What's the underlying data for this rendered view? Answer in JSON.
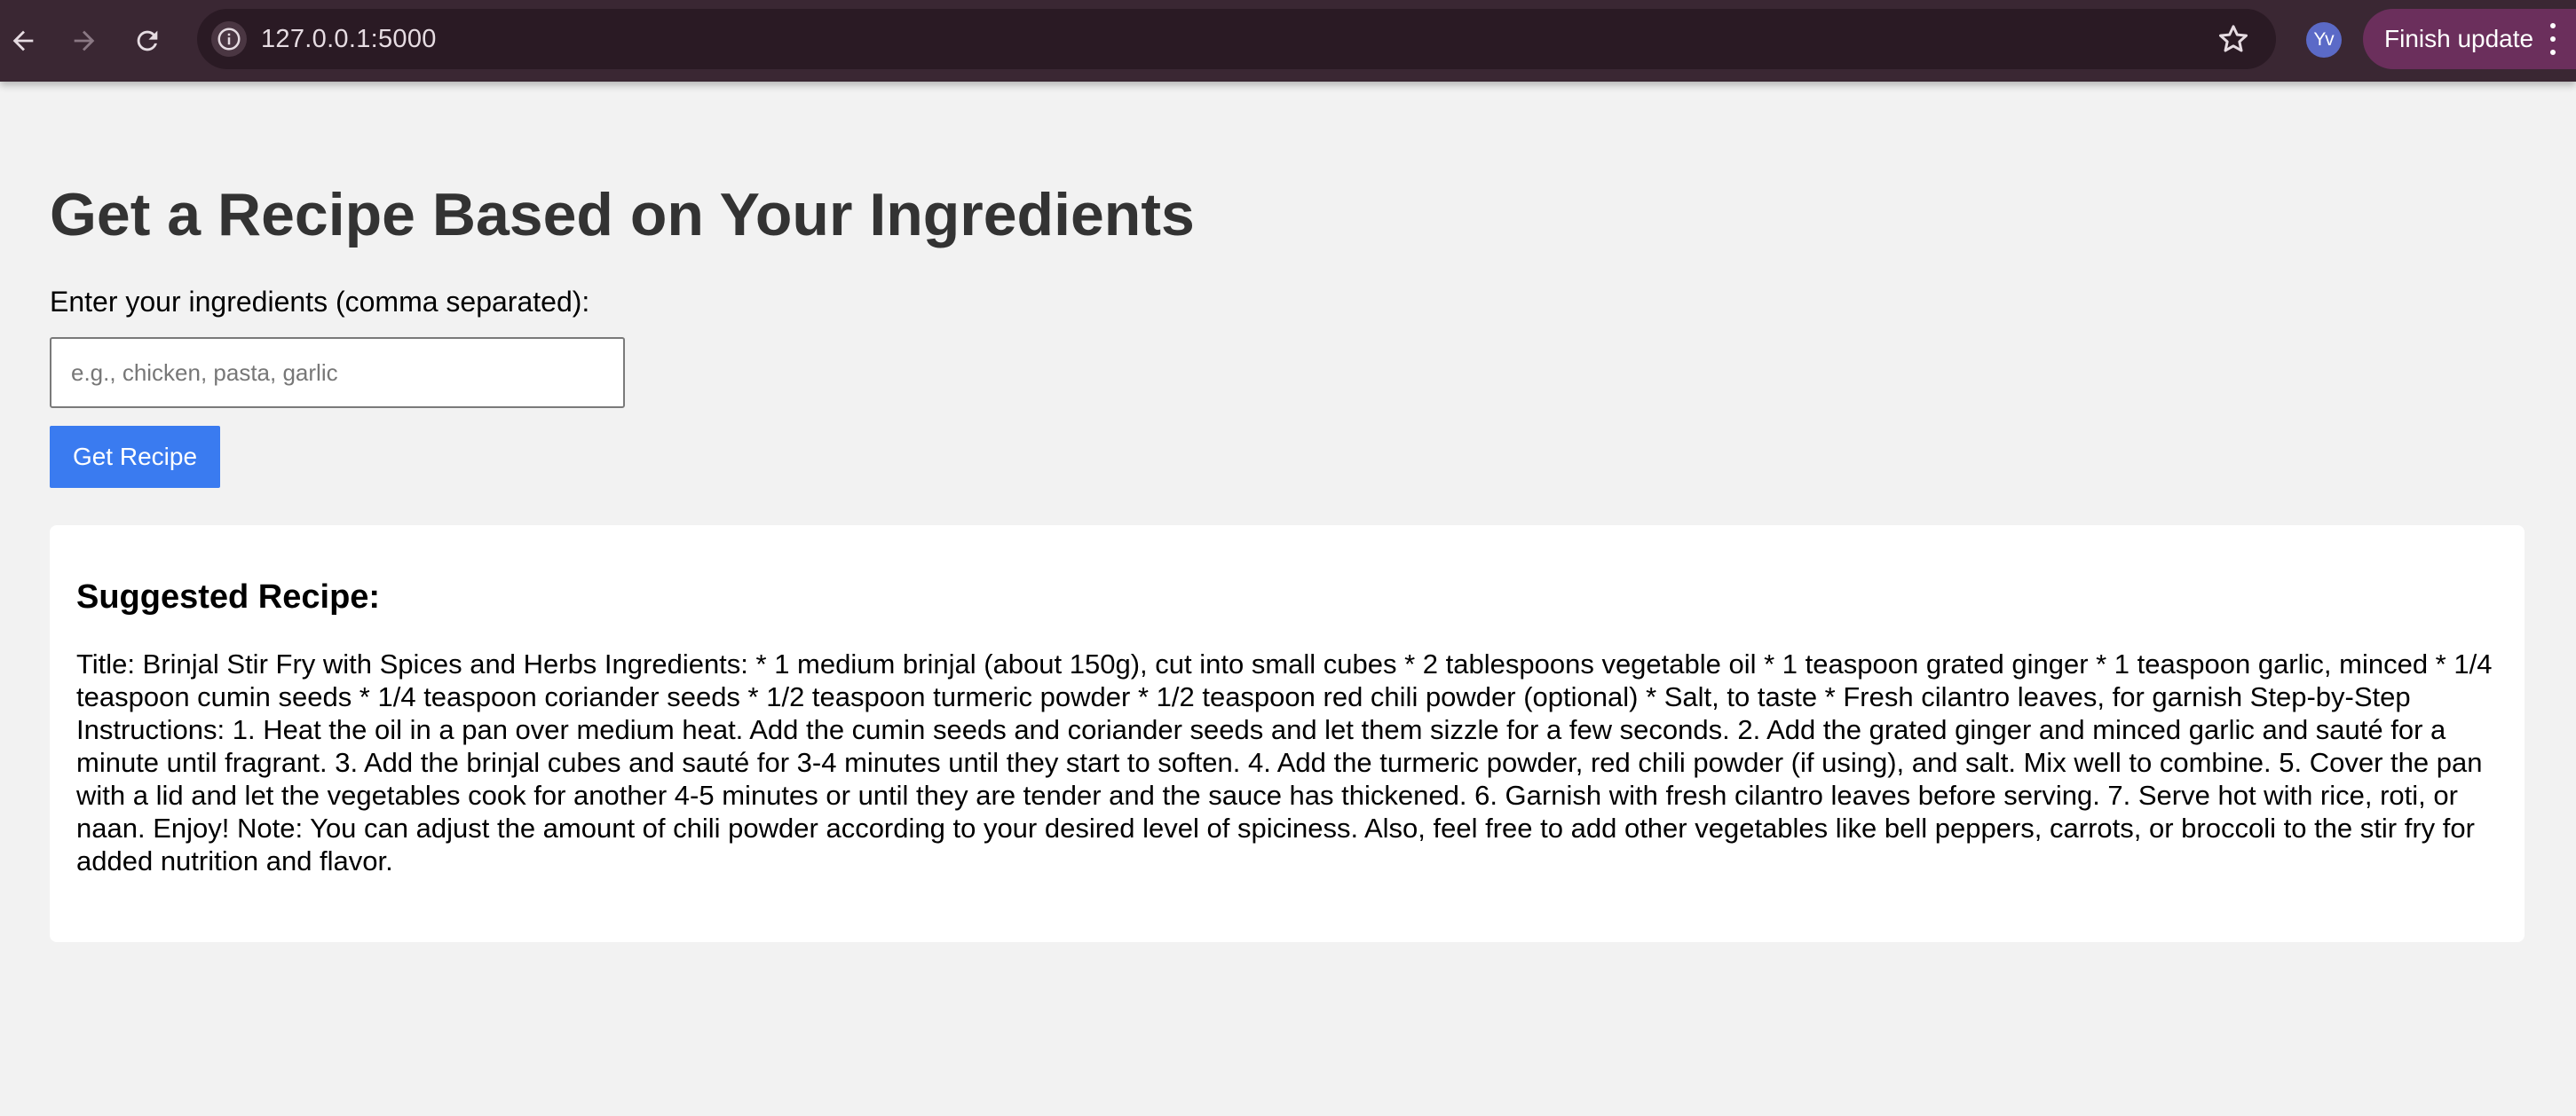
{
  "browser": {
    "url": "127.0.0.1:5000",
    "avatar_initials": "Yv",
    "finish_update_label": "Finish update",
    "icons": [
      "back-arrow-icon",
      "forward-arrow-icon",
      "reload-icon",
      "info-icon",
      "star-icon",
      "more-vert-icon"
    ],
    "colors": {
      "toolbar": "#3a2733",
      "omnibox": "#2a1a24",
      "update_button": "#6b2f5c",
      "avatar": "#5b6ac7"
    }
  },
  "page": {
    "title": "Get a Recipe Based on Your Ingredients",
    "input_label": "Enter your ingredients (comma separated):",
    "input_placeholder": "e.g., chicken, pasta, garlic",
    "input_value": "",
    "button_label": "Get Recipe",
    "recipe_heading": "Suggested Recipe:",
    "recipe_text": "Title: Brinjal Stir Fry with Spices and Herbs Ingredients: * 1 medium brinjal (about 150g), cut into small cubes * 2 tablespoons vegetable oil * 1 teaspoon grated ginger * 1 teaspoon garlic, minced * 1/4 teaspoon cumin seeds * 1/4 teaspoon coriander seeds * 1/2 teaspoon turmeric powder * 1/2 teaspoon red chili powder (optional) * Salt, to taste * Fresh cilantro leaves, for garnish Step-by-Step Instructions: 1. Heat the oil in a pan over medium heat. Add the cumin seeds and coriander seeds and let them sizzle for a few seconds. 2. Add the grated ginger and minced garlic and sauté for a minute until fragrant. 3. Add the brinjal cubes and sauté for 3-4 minutes until they start to soften. 4. Add the turmeric powder, red chili powder (if using), and salt. Mix well to combine. 5. Cover the pan with a lid and let the vegetables cook for another 4-5 minutes or until they are tender and the sauce has thickened. 6. Garnish with fresh cilantro leaves before serving. 7. Serve hot with rice, roti, or naan. Enjoy! Note: You can adjust the amount of chili powder according to your desired level of spiciness. Also, feel free to add other vegetables like bell peppers, carrots, or broccoli to the stir fry for added nutrition and flavor.",
    "colors": {
      "background": "#f2f2f2",
      "button": "#3a7bf0",
      "title": "#333333",
      "card": "#ffffff"
    }
  }
}
